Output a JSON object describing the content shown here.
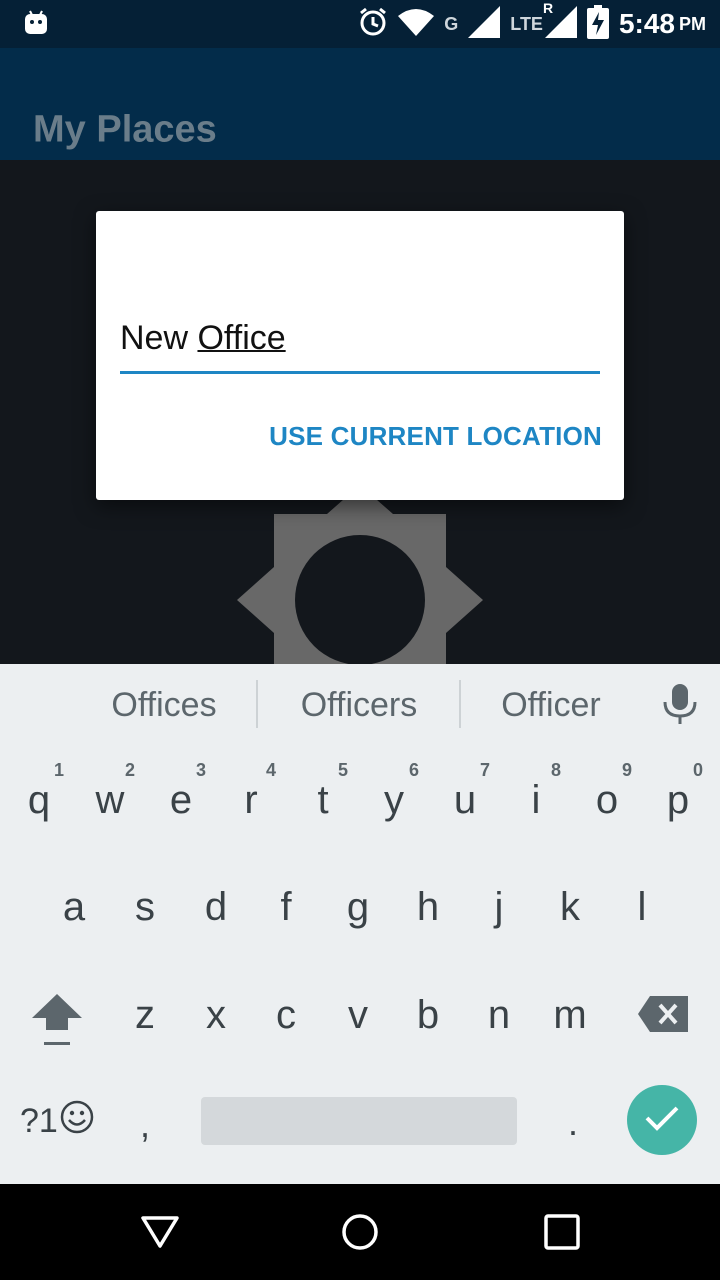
{
  "status_bar": {
    "network_label": "G",
    "lte_label": "LTE",
    "roaming_label": "R",
    "time": "5:48",
    "ampm": "PM",
    "icons": [
      "android-debug-icon",
      "alarm-icon",
      "wifi-icon",
      "signal-icon",
      "signal-icon",
      "battery-charging-icon"
    ]
  },
  "app_bar": {
    "title": "My Places"
  },
  "dialog": {
    "input_word1": "New ",
    "input_word2": "Office",
    "action_label": "USE CURRENT LOCATION",
    "accent_color": "#1e86c4"
  },
  "suggestions": {
    "items": [
      "Offices",
      "Officers",
      "Officer"
    ],
    "mic_icon": "mic-icon"
  },
  "keyboard": {
    "row1": [
      {
        "key": "q",
        "hint": "1"
      },
      {
        "key": "w",
        "hint": "2"
      },
      {
        "key": "e",
        "hint": "3"
      },
      {
        "key": "r",
        "hint": "4"
      },
      {
        "key": "t",
        "hint": "5"
      },
      {
        "key": "y",
        "hint": "6"
      },
      {
        "key": "u",
        "hint": "7"
      },
      {
        "key": "i",
        "hint": "8"
      },
      {
        "key": "o",
        "hint": "9"
      },
      {
        "key": "p",
        "hint": "0"
      }
    ],
    "row2": [
      "a",
      "s",
      "d",
      "f",
      "g",
      "h",
      "j",
      "k",
      "l"
    ],
    "row3": [
      "z",
      "x",
      "c",
      "v",
      "b",
      "n",
      "m"
    ],
    "symbols_label": "?1",
    "comma": ",",
    "period": ".",
    "enter_color": "#45b5a7"
  },
  "nav_bar": {
    "icons": [
      "back-icon",
      "home-icon",
      "recents-icon"
    ]
  }
}
